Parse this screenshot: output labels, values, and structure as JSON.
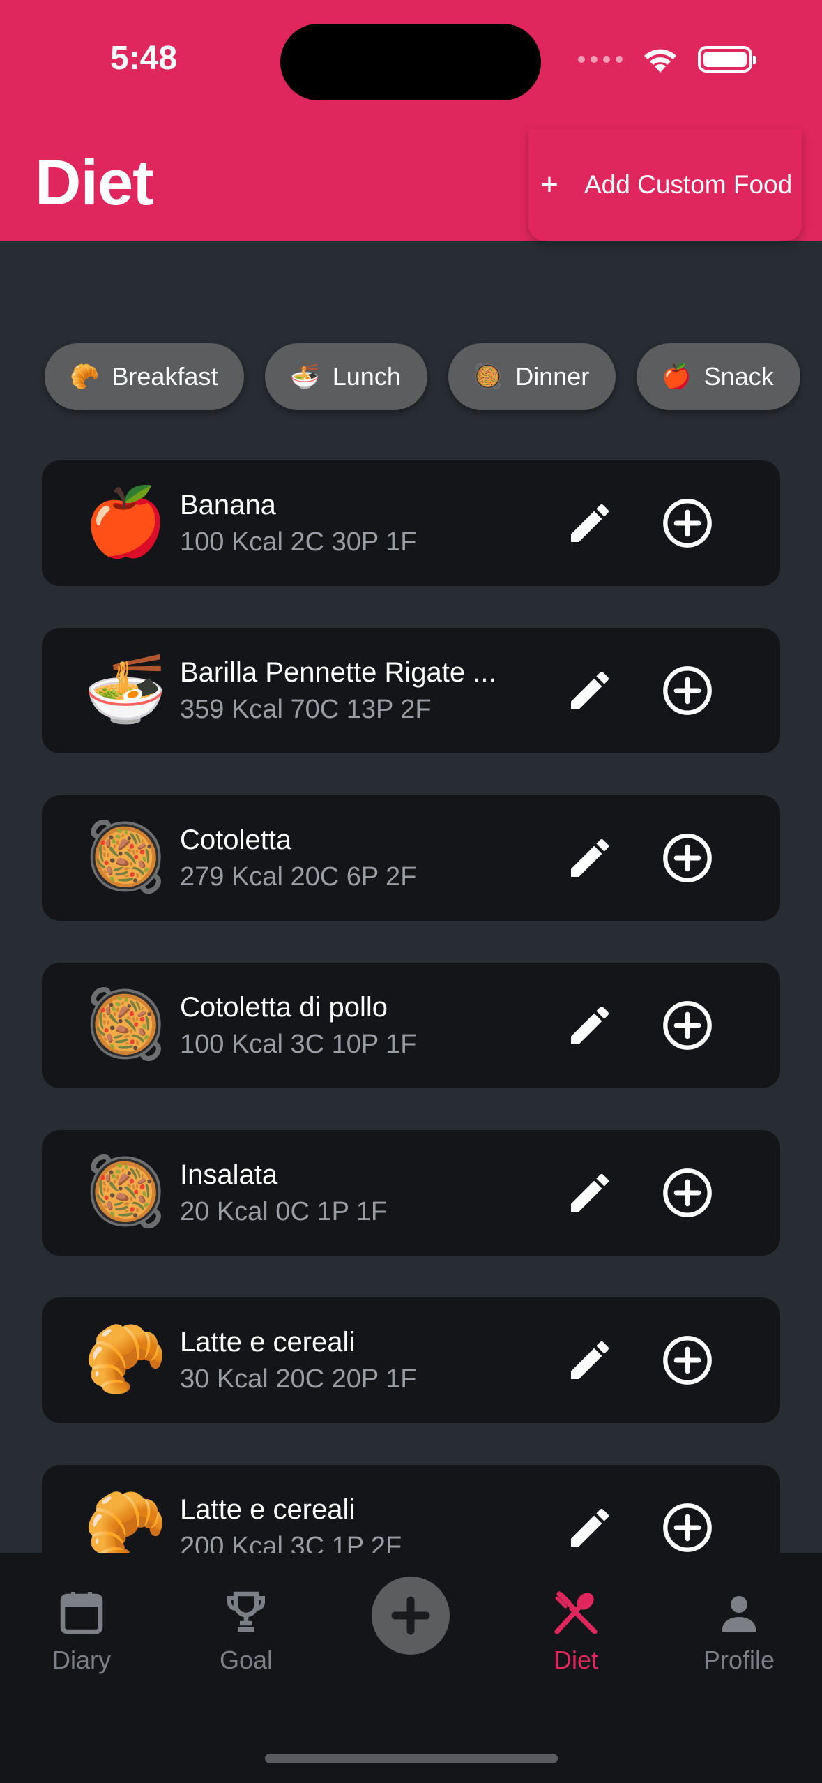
{
  "status_bar": {
    "time": "5:48"
  },
  "header": {
    "title": "Diet",
    "add_custom_label": "Add Custom Food",
    "accent_color": "#e0275d"
  },
  "meal_chips": [
    {
      "emoji": "🥐",
      "label": "Breakfast"
    },
    {
      "emoji": "🍜",
      "label": "Lunch"
    },
    {
      "emoji": "🥘",
      "label": "Dinner"
    },
    {
      "emoji": "🍎",
      "label": "Snack"
    }
  ],
  "foods": [
    {
      "emoji": "🍎",
      "name": "Banana",
      "macros": "100 Kcal 2C 30P 1F"
    },
    {
      "emoji": "🍜",
      "name": "Barilla Pennette Rigate ...",
      "macros": "359 Kcal 70C 13P 2F"
    },
    {
      "emoji": "🥘",
      "name": "Cotoletta",
      "macros": "279 Kcal 20C 6P 2F"
    },
    {
      "emoji": "🥘",
      "name": "Cotoletta di pollo",
      "macros": "100 Kcal 3C 10P 1F"
    },
    {
      "emoji": "🥘",
      "name": "Insalata",
      "macros": "20 Kcal 0C 1P 1F"
    },
    {
      "emoji": "🥐",
      "name": "Latte e cereali",
      "macros": "30 Kcal 20C 20P 1F"
    },
    {
      "emoji": "🥐",
      "name": "Latte e cereali",
      "macros": "200 Kcal 3C 1P 2F"
    }
  ],
  "tabbar": {
    "diary": "Diary",
    "goal": "Goal",
    "diet": "Diet",
    "profile": "Profile",
    "active": "diet"
  },
  "icons": {
    "edit": "pencil-icon",
    "add": "plus-circle-icon",
    "diary": "calendar-icon",
    "goal": "trophy-icon",
    "diet": "fork-spoon-icon",
    "profile": "person-icon"
  }
}
